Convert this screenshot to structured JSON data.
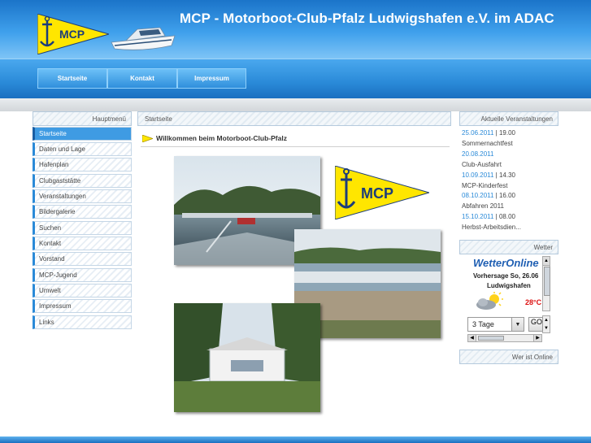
{
  "header": {
    "title": "MCP - Motorboot-Club-Pfalz Ludwigshafen e.V. im ADAC",
    "logo_text": "MCP"
  },
  "nav": {
    "items": [
      "Startseite",
      "Kontakt",
      "Impressum"
    ]
  },
  "menu": {
    "heading": "Hauptmenü",
    "items": [
      {
        "label": "Startseite"
      },
      {
        "label": "Daten und Lage"
      },
      {
        "label": "Hafenplan"
      },
      {
        "label": "Clubgaststätte"
      },
      {
        "label": "Veranstaltungen"
      },
      {
        "label": "Bildergalerie"
      },
      {
        "label": "Suchen"
      },
      {
        "label": "Kontakt"
      },
      {
        "label": "Vorstand"
      },
      {
        "label": "MCP-Jugend"
      },
      {
        "label": "Umwelt"
      },
      {
        "label": "Impressum"
      },
      {
        "label": "Links"
      }
    ]
  },
  "content": {
    "breadcrumb": "Startseite",
    "welcome": "Willkommen beim Motorboot-Club-Pfalz",
    "logo_text": "MCP"
  },
  "events": {
    "heading": "Aktuelle Veranstaltungen",
    "items": [
      {
        "date": "25.06.2011",
        "time": " | 19.00",
        "title": "Sommernachtfest"
      },
      {
        "date": "20.08.2011",
        "time": "",
        "title": "Club-Ausfahrt"
      },
      {
        "date": "10.09.2011",
        "time": " | 14.30",
        "title": "MCP-Kinderfest"
      },
      {
        "date": "08.10.2011",
        "time": " | 16.00",
        "title": "Abfahren 2011"
      },
      {
        "date": "15.10.2011",
        "time": " | 08.00",
        "title": "Herbst-Arbeitsdien..."
      }
    ]
  },
  "weather": {
    "heading": "Wetter",
    "brand": "WetterOnline",
    "forecast": "Vorhersage So, 26.06",
    "city": "Ludwigshafen",
    "temp": "28°C",
    "days_select": "3 Tage",
    "go_label": "GO"
  },
  "online": {
    "heading": "Wer ist Online"
  },
  "colors": {
    "header_blue": "#1b74c9",
    "accent_blue": "#2a8ad8",
    "flag_yellow": "#ffe600"
  }
}
